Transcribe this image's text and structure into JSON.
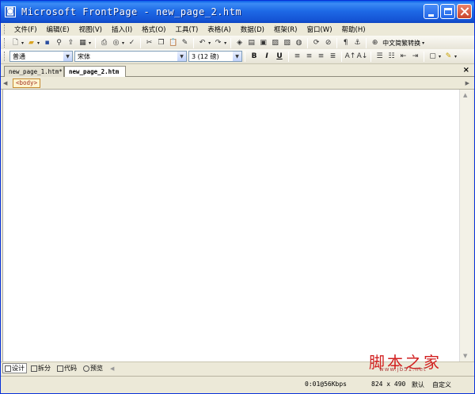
{
  "window": {
    "title": "Microsoft FrontPage - new_page_2.htm"
  },
  "menu": [
    "文件(F)",
    "编辑(E)",
    "视图(V)",
    "插入(I)",
    "格式(O)",
    "工具(T)",
    "表格(A)",
    "数据(D)",
    "框架(R)",
    "窗口(W)",
    "帮助(H)"
  ],
  "toolbar_standard": {
    "convert_label": "中文简繁转换"
  },
  "toolbar_format": {
    "style_value": "普通",
    "font_value": "宋体",
    "size_value": "3 (12 磅)",
    "bold": "B",
    "italic": "I",
    "underline": "U"
  },
  "tabs": [
    {
      "label": "new_page_1.htm*"
    },
    {
      "label": "new_page_2.htm"
    }
  ],
  "tagbar": {
    "tag": "<body>"
  },
  "views": [
    {
      "label": "设计"
    },
    {
      "label": "拆分"
    },
    {
      "label": "代码"
    },
    {
      "label": "预览"
    }
  ],
  "status": {
    "speed": "0:01@56Kbps",
    "size": "824 x 490",
    "default": "默认",
    "custom": "自定义"
  },
  "watermark": {
    "text": "脚本之家",
    "url": "www.jb51.net"
  }
}
